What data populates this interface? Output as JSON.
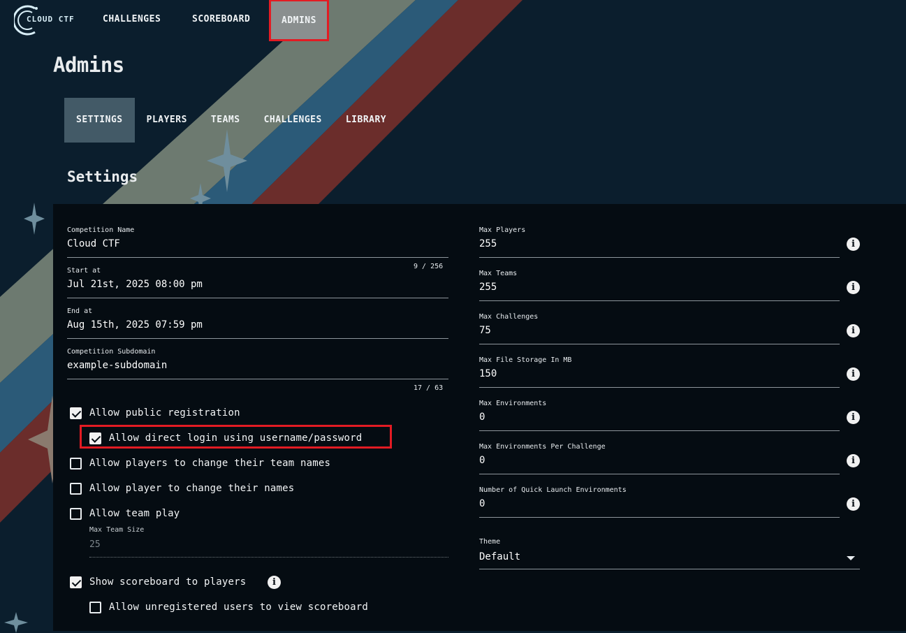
{
  "app": {
    "logo_text": "CLOUD CTF"
  },
  "nav": {
    "challenges": "CHALLENGES",
    "scoreboard": "SCOREBOARD",
    "admins": "ADMINS"
  },
  "page": {
    "title": "Admins",
    "section_title": "Settings"
  },
  "tabs": {
    "settings": "SETTINGS",
    "players": "PLAYERS",
    "teams": "TEAMS",
    "challenges": "CHALLENGES",
    "library": "LIBRARY"
  },
  "left": {
    "competition_name": {
      "label": "Competition Name",
      "value": "Cloud CTF",
      "counter": "9 / 256"
    },
    "start_at": {
      "label": "Start at",
      "value": "Jul 21st, 2025 08:00 pm"
    },
    "end_at": {
      "label": "End at",
      "value": "Aug 15th, 2025 07:59 pm"
    },
    "subdomain": {
      "label": "Competition Subdomain",
      "value": "example-subdomain",
      "counter": "17 / 63"
    },
    "checkboxes": {
      "public_registration": {
        "label": "Allow public registration",
        "checked": true
      },
      "direct_login": {
        "label": "Allow direct login using username/password",
        "checked": true
      },
      "change_team_names": {
        "label": "Allow players to change their team names",
        "checked": false
      },
      "change_names": {
        "label": "Allow player to change their names",
        "checked": false
      },
      "team_play": {
        "label": "Allow team play",
        "checked": false
      },
      "show_scoreboard": {
        "label": "Show scoreboard to players",
        "checked": true
      },
      "unregistered_scoreboard": {
        "label": "Allow unregistered users to view scoreboard",
        "checked": false
      }
    },
    "max_team_size": {
      "label": "Max Team Size",
      "value": "25"
    }
  },
  "right": {
    "max_players": {
      "label": "Max Players",
      "value": "255"
    },
    "max_teams": {
      "label": "Max Teams",
      "value": "255"
    },
    "max_challenges": {
      "label": "Max Challenges",
      "value": "75"
    },
    "max_file_storage": {
      "label": "Max File Storage In MB",
      "value": "150"
    },
    "max_environments": {
      "label": "Max Environments",
      "value": "0"
    },
    "max_env_per_challenge": {
      "label": "Max Environments Per Challenge",
      "value": "0"
    },
    "quick_launch": {
      "label": "Number of Quick Launch Environments",
      "value": "0"
    },
    "theme": {
      "label": "Theme",
      "value": "Default"
    }
  },
  "icons": {
    "info": "i"
  },
  "colors": {
    "background": "#0b1e2d",
    "panel": "#050c12",
    "stripe_gray": "#6d7a70",
    "stripe_blue": "#2b5a78",
    "stripe_red": "#6b2d2b",
    "highlight": "#e31b23",
    "active_tab": "#435a67"
  }
}
